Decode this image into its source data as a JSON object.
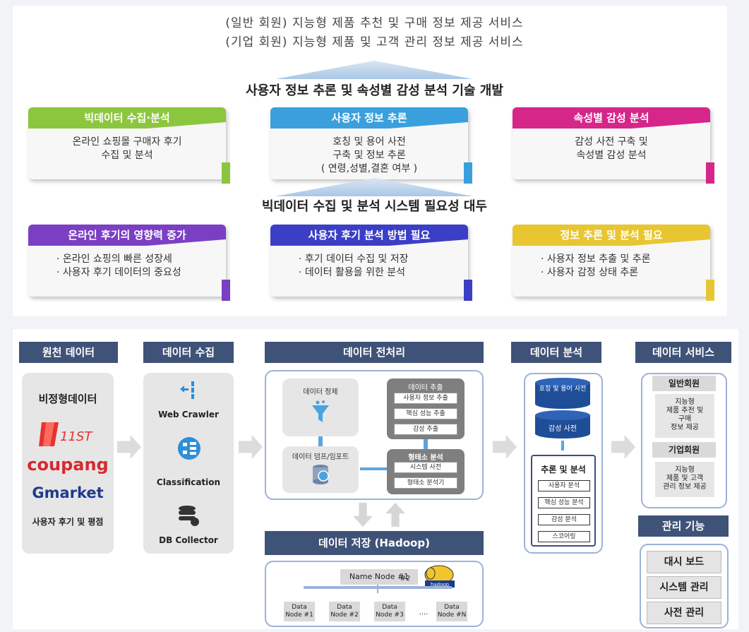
{
  "goals": {
    "line1": "(일반 회원) 지능형 제품 추천 및 구매 정보 제공 서비스",
    "line2": "(기업 회원) 지능형 제품 및 고객 관리 정보 제공 서비스"
  },
  "tech_banner": "사용자 정보 추론 및 속성별 감성 분석 기술 개발",
  "tech_cards": [
    {
      "title": "빅데이터 수집·분석",
      "lines": [
        "온라인 쇼핑몰 구매자 후기",
        "수집 및 분석"
      ],
      "color": "#8cc63f"
    },
    {
      "title": "사용자 정보 추론",
      "lines": [
        "호칭 및 용어 사전",
        "구축 및 정보 추론",
        "( 연령,성별,결혼 여부 )"
      ],
      "color": "#3aa0dd"
    },
    {
      "title": "속성별 감성 분석",
      "lines": [
        "감성 사전 구축 및",
        "속성별 감성 분석"
      ],
      "color": "#d6268a"
    }
  ],
  "need_banner": "빅데이터 수집 및 분석 시스템 필요성 대두",
  "need_cards": [
    {
      "title": "온라인 후기의 영향력 증가",
      "lines": [
        "· 온라인 쇼핑의 빠른 성장세",
        "· 사용자 후기 데이터의 중요성"
      ],
      "color": "#7b3fc4"
    },
    {
      "title": "사용자 후기 분석 방법 필요",
      "lines": [
        "· 후기 데이터 수집 및 저장",
        "· 데이터 활용을 위한 분석"
      ],
      "color": "#3b3fc6"
    },
    {
      "title": "정보 추론 및 분석 필요",
      "lines": [
        "· 사용자 정보 추출 및 추론",
        "· 사용자 감정 상태 추론"
      ],
      "color": "#e8c632"
    }
  ],
  "source": {
    "header": "원천 데이터",
    "label": "비정형데이터",
    "logo_11st": "11ST",
    "logo_coupang": "coupang",
    "logo_gmarket": "Gmarket",
    "footer": "사용자 후기 및 평점"
  },
  "collect": {
    "header": "데이터 수집",
    "items": [
      "Web Crawler",
      "Classification",
      "DB Collector"
    ]
  },
  "preprocess": {
    "header": "데이터 전처리",
    "refine": "데이터 정제",
    "extract_title": "데이터 추출",
    "extract_items": [
      "사용자 정보 추출",
      "핵심 성능 추출",
      "감성 추출"
    ],
    "dump": "데이터 덤프/임포트",
    "morph_title": "형태소 분석",
    "morph_items": [
      "시스템 사전",
      "형태소 분석기"
    ]
  },
  "storage": {
    "header": "데이터 저장 (Hadoop)",
    "name_node": "Name Node #1",
    "name_node2": "#2",
    "hadoop_logo": "hadoop",
    "data_nodes": [
      "Data Node #1",
      "Data Node #2",
      "Data Node #3",
      "Data Node #N"
    ],
    "ellipsis": "...."
  },
  "analysis": {
    "header": "데이터 분석",
    "db1": "호칭 및 용어 사전",
    "db2": "감성 사전",
    "infer_title": "추론 및 분석",
    "infer_items": [
      "사용자 분석",
      "핵심 성능 분석",
      "감성 분석",
      "스코어링"
    ]
  },
  "service": {
    "header": "데이터 서비스",
    "general_title": "일반회원",
    "general_body": [
      "지능형",
      "제품 추천 및",
      "구매",
      "정보 제공"
    ],
    "corp_title": "기업회원",
    "corp_body": [
      "지능형",
      "제품 및 고객",
      "관리 정보 제공"
    ]
  },
  "admin": {
    "header": "관리 기능",
    "items": [
      "대시 보드",
      "시스템 관리",
      "사전 관리"
    ]
  }
}
